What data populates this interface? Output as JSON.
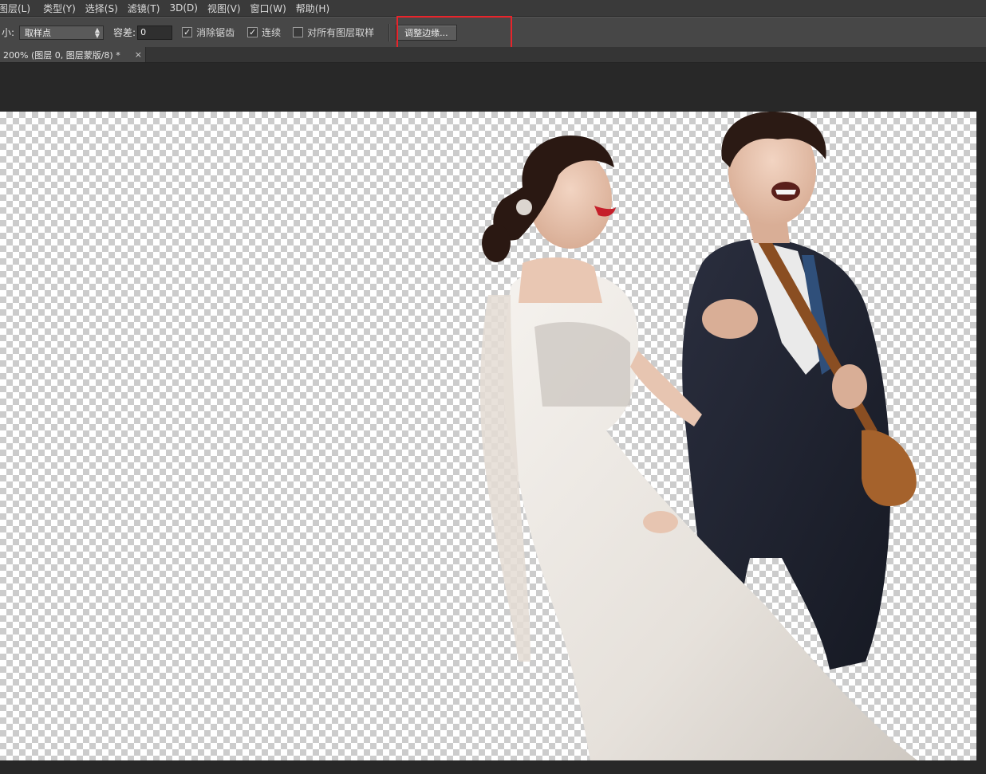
{
  "menu": {
    "items": [
      "图层(L)",
      "类型(Y)",
      "选择(S)",
      "滤镜(T)",
      "3D(D)",
      "视图(V)",
      "窗口(W)",
      "帮助(H)"
    ]
  },
  "options": {
    "sample_size_label": "小:",
    "sample_size_value": "取样点",
    "tolerance_label": "容差:",
    "tolerance_value": "0",
    "anti_alias_label": "消除锯齿",
    "anti_alias_checked": true,
    "contiguous_label": "连续",
    "contiguous_checked": true,
    "sample_all_layers_label": "对所有图层取样",
    "sample_all_layers_checked": false,
    "refine_edge_label": "调整边缘..."
  },
  "document": {
    "tab_label": "200% (图层 0, 图层蒙版/8) *",
    "close_glyph": "×"
  },
  "colors": {
    "highlight": "#e8242b",
    "dress": "#f2efea",
    "suit": "#1f2230"
  }
}
